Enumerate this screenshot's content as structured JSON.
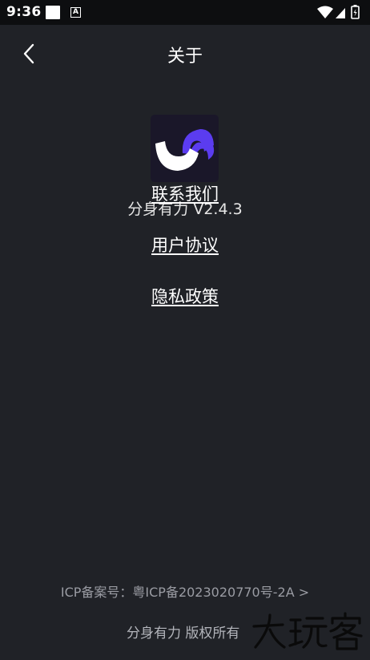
{
  "status_bar": {
    "time": "9:36",
    "icons": [
      "notification-square-icon",
      "a-box-icon",
      "wifi-icon",
      "signal-icon",
      "battery-charging-icon"
    ],
    "a_label": "A"
  },
  "header": {
    "title": "关于",
    "back_icon": "chevron-left-icon"
  },
  "app": {
    "logo_colors": {
      "background": "#1a1729",
      "purple": "#5b3cf0",
      "white": "#ffffff"
    },
    "version": "分身有力 V2.4.3"
  },
  "links": {
    "contact": "联系我们",
    "agreement": "用户协议",
    "privacy": "隐私政策"
  },
  "footer": {
    "icp": "ICP备案号：粤ICP备2023020770号-2A >",
    "copyright": "分身有力 版权所有",
    "watermark": "大玩客"
  }
}
